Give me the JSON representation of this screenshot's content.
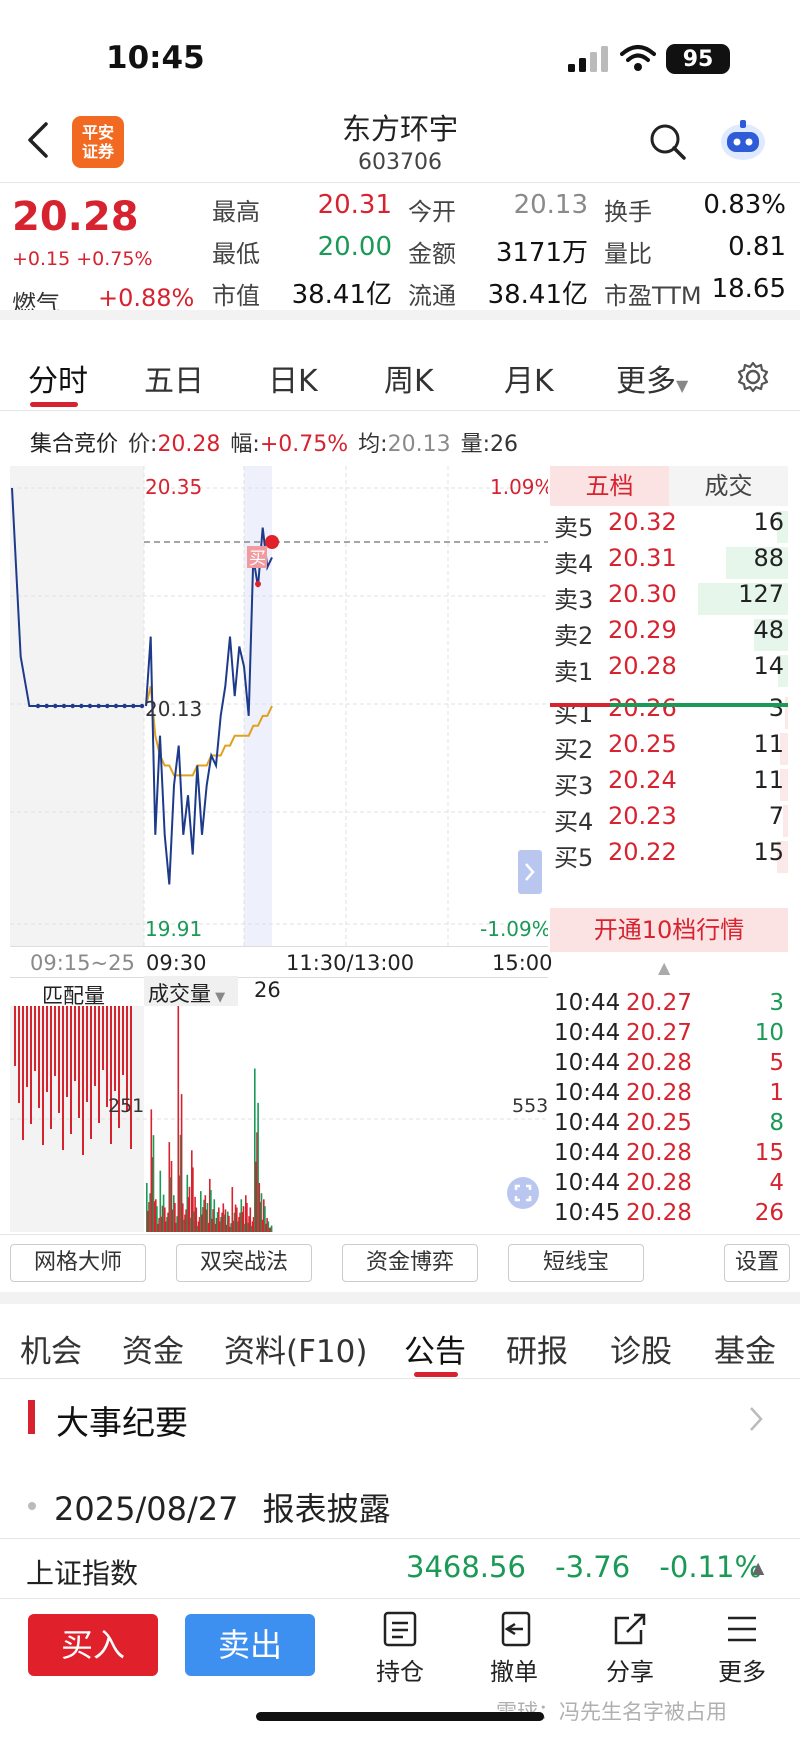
{
  "status": {
    "time": "10:45",
    "battery": "95"
  },
  "header": {
    "broker_logo": "平安\n证券",
    "name": "东方环宇",
    "code": "603706"
  },
  "quote": {
    "price": "20.28",
    "change": "+0.15 +0.75%",
    "sector": "燃气",
    "sector_change": "+0.88%",
    "fields": [
      {
        "label": "最高",
        "value": "20.31",
        "color": "red"
      },
      {
        "label": "今开",
        "value": "20.13",
        "color": "gray"
      },
      {
        "label": "换手",
        "value": "0.83%",
        "color": "black"
      },
      {
        "label": "最低",
        "value": "20.00",
        "color": "green"
      },
      {
        "label": "金额",
        "value": "3171万",
        "color": "black"
      },
      {
        "label": "量比",
        "value": "0.81",
        "color": "black"
      },
      {
        "label": "市值",
        "value": "38.41亿",
        "color": "black"
      },
      {
        "label": "流通",
        "value": "38.41亿",
        "color": "black"
      },
      {
        "label": "市盈TTM",
        "value": "18.65",
        "color": "black"
      }
    ]
  },
  "chart_tabs": [
    "分时",
    "五日",
    "日K",
    "周K",
    "月K",
    "更多"
  ],
  "auction": {
    "label": "集合竞价",
    "price_label": "价:",
    "price": "20.28",
    "range_label": "幅:",
    "range": "+0.75%",
    "avg_label": "均:",
    "avg": "20.13",
    "vol_label": "量:",
    "vol": "26"
  },
  "chart_labels": {
    "high": "20.35",
    "high_pct": "1.09%",
    "mid": "20.13",
    "low": "19.91",
    "low_pct": "-1.09%",
    "time_auction": "09:15~25",
    "time_open": "09:30",
    "time_mid": "11:30/13:00",
    "time_close": "15:00",
    "buy_marker": "买",
    "vol_left_title": "匹配量",
    "vol_dropdown": "成交量",
    "vol_value": "26",
    "vol_left_axis": "251",
    "vol_right_axis": "553"
  },
  "chart_data": {
    "type": "line",
    "ylim": [
      19.91,
      20.35
    ],
    "auction_series": [
      20.35,
      20.18,
      20.13,
      20.13,
      20.13,
      20.13,
      20.13,
      20.13,
      20.13,
      20.13,
      20.13,
      20.13,
      20.13,
      20.13,
      20.13,
      20.13
    ],
    "price_series": [
      20.13,
      20.2,
      20.0,
      20.1,
      20.0,
      19.95,
      20.05,
      20.09,
      20.0,
      20.04,
      19.98,
      20.07,
      20.0,
      20.05,
      20.08,
      20.07,
      20.12,
      20.15,
      20.2,
      20.14,
      20.19,
      20.17,
      20.12,
      20.28,
      20.25,
      20.31,
      20.27,
      20.28
    ],
    "avg_series": [
      20.13,
      20.15,
      20.1,
      20.08,
      20.07,
      20.07,
      20.06,
      20.06,
      20.06,
      20.06,
      20.06,
      20.07,
      20.07,
      20.07,
      20.08,
      20.08,
      20.08,
      20.09,
      20.09,
      20.1,
      20.1,
      20.1,
      20.1,
      20.11,
      20.11,
      20.12,
      20.12,
      20.13
    ],
    "volume_series": [
      120,
      300,
      80,
      150,
      60,
      220,
      90,
      553,
      70,
      140,
      200,
      60,
      100,
      90,
      130,
      80,
      60,
      70,
      50,
      110,
      60,
      80,
      90,
      60,
      400,
      120,
      80,
      26
    ]
  },
  "orderbook": {
    "tabs": [
      "五档",
      "成交"
    ],
    "asks": [
      {
        "label": "卖5",
        "price": "20.32",
        "vol": "16",
        "bar": 0.12
      },
      {
        "label": "卖4",
        "price": "20.31",
        "vol": "88",
        "bar": 0.69
      },
      {
        "label": "卖3",
        "price": "20.30",
        "vol": "127",
        "bar": 1.0
      },
      {
        "label": "卖2",
        "price": "20.29",
        "vol": "48",
        "bar": 0.38
      },
      {
        "label": "卖1",
        "price": "20.28",
        "vol": "14",
        "bar": 0.11
      }
    ],
    "bids": [
      {
        "label": "买1",
        "price": "20.26",
        "vol": "3",
        "bar": 0.03
      },
      {
        "label": "买2",
        "price": "20.25",
        "vol": "11",
        "bar": 0.09
      },
      {
        "label": "买3",
        "price": "20.24",
        "vol": "11",
        "bar": 0.09
      },
      {
        "label": "买4",
        "price": "20.23",
        "vol": "7",
        "bar": 0.06
      },
      {
        "label": "买5",
        "price": "20.22",
        "vol": "15",
        "bar": 0.12
      }
    ],
    "upgrade": "开通10档行情"
  },
  "ticks": [
    {
      "time": "10:44",
      "price": "20.27",
      "vol": "3",
      "side": "sell"
    },
    {
      "time": "10:44",
      "price": "20.27",
      "vol": "10",
      "side": "sell"
    },
    {
      "time": "10:44",
      "price": "20.28",
      "vol": "5",
      "side": "buy"
    },
    {
      "time": "10:44",
      "price": "20.28",
      "vol": "1",
      "side": "buy"
    },
    {
      "time": "10:44",
      "price": "20.25",
      "vol": "8",
      "side": "sell"
    },
    {
      "time": "10:44",
      "price": "20.28",
      "vol": "15",
      "side": "buy"
    },
    {
      "time": "10:44",
      "price": "20.28",
      "vol": "4",
      "side": "buy"
    },
    {
      "time": "10:45",
      "price": "20.28",
      "vol": "26",
      "side": "buy"
    }
  ],
  "tools": [
    "网格大师",
    "双突战法",
    "资金博弈",
    "短线宝",
    "设置"
  ],
  "news_tabs": [
    "机会",
    "资金",
    "资料(F10)",
    "公告",
    "研报",
    "诊股",
    "基金"
  ],
  "section": {
    "title": "大事纪要",
    "event_date": "2025/08/27",
    "event_text": "报表披露"
  },
  "index": {
    "name": "上证指数",
    "value": "3468.56",
    "change": "-3.76",
    "pct": "-0.11%"
  },
  "bottom": {
    "buy": "买入",
    "sell": "卖出",
    "actions": [
      "持仓",
      "撤单",
      "分享",
      "更多"
    ],
    "watermark": "雪球：冯先生名字被占用"
  },
  "colors": {
    "red": "#d6232f",
    "green": "#1a9a56",
    "blue": "#3d8ff0",
    "orange": "#f26a21",
    "line": "#1e3a8a",
    "avg": "#e0a020"
  }
}
